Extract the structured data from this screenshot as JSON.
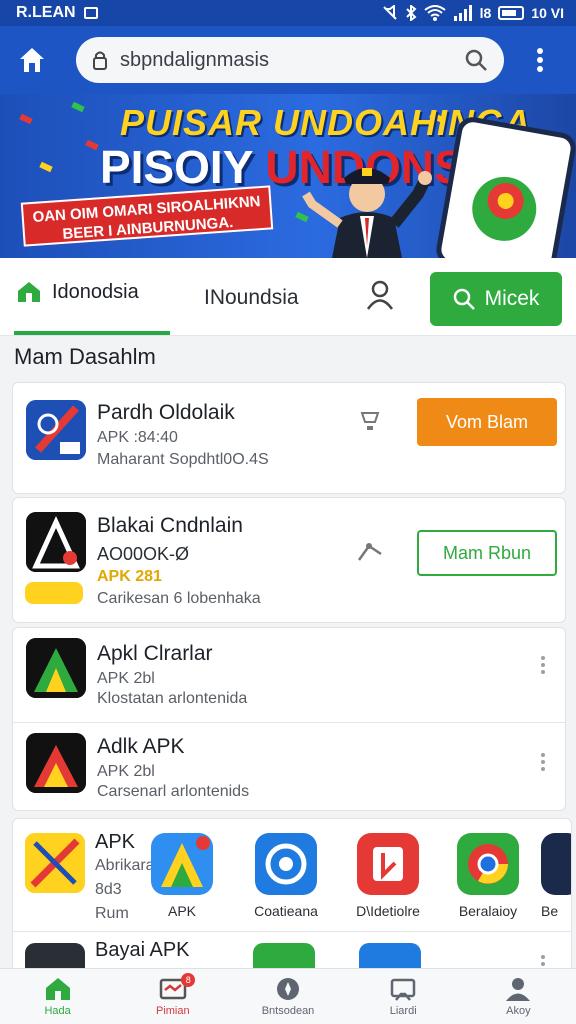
{
  "status_bar": {
    "carrier": "R.LEAN",
    "time": "10 VI",
    "signal_text": "l8"
  },
  "toolbar": {
    "url_text": "sbpndalignmasis"
  },
  "banner": {
    "title": "PUISAR UNDOAHINGA",
    "subtitle_part1": "PISOIY ",
    "subtitle_part2": "UNDONSIA",
    "promo_line1": "OAN OIM OMARI SIROALHIKNN",
    "promo_line2": "BEER I AINBURNUNGA."
  },
  "tabs": {
    "home_label": "Idonodsia",
    "second_label": "INoundsia",
    "search_button": "Micek"
  },
  "section_title": "Mam Dasahlm",
  "apps": [
    {
      "name": "Pardh Oldolaik",
      "line1": "APK :84:40",
      "line2": "Maharant Sopdhtl0O.4S",
      "button": "Vom Blam"
    },
    {
      "name": "Blakai Cndnlain",
      "line1": "AO00OK-Ø",
      "line2": "APK 281",
      "line3": "Carikesan 6 lobenhaka",
      "button": "Mam Rbun"
    },
    {
      "name": "Apkl Clrarlar",
      "line1": "APK 2bl",
      "line2": "Klostatan arlontenida"
    },
    {
      "name": "Adlk APK",
      "line1": "APK 2bl",
      "line2": "Carsenarl arlontenids"
    }
  ],
  "featured": {
    "name": "APK",
    "line1": "Abrikara",
    "line2": "8d3",
    "line3": "Rum"
  },
  "grid_apps": [
    {
      "label": "APK"
    },
    {
      "label": "Coatieana"
    },
    {
      "label": "D\\Idetiolre"
    },
    {
      "label": "Beralaioy"
    },
    {
      "label": "Be"
    }
  ],
  "bottom_row": {
    "name": "Bayai APK"
  },
  "bottom_nav": [
    {
      "label": "Hada"
    },
    {
      "label": "Pimian",
      "badge": "8"
    },
    {
      "label": "Bntsodean"
    },
    {
      "label": "Liardi"
    },
    {
      "label": "Akoy"
    }
  ],
  "colors": {
    "primary_blue": "#1d56c4",
    "green": "#2eaa3f",
    "orange": "#f08a16"
  }
}
